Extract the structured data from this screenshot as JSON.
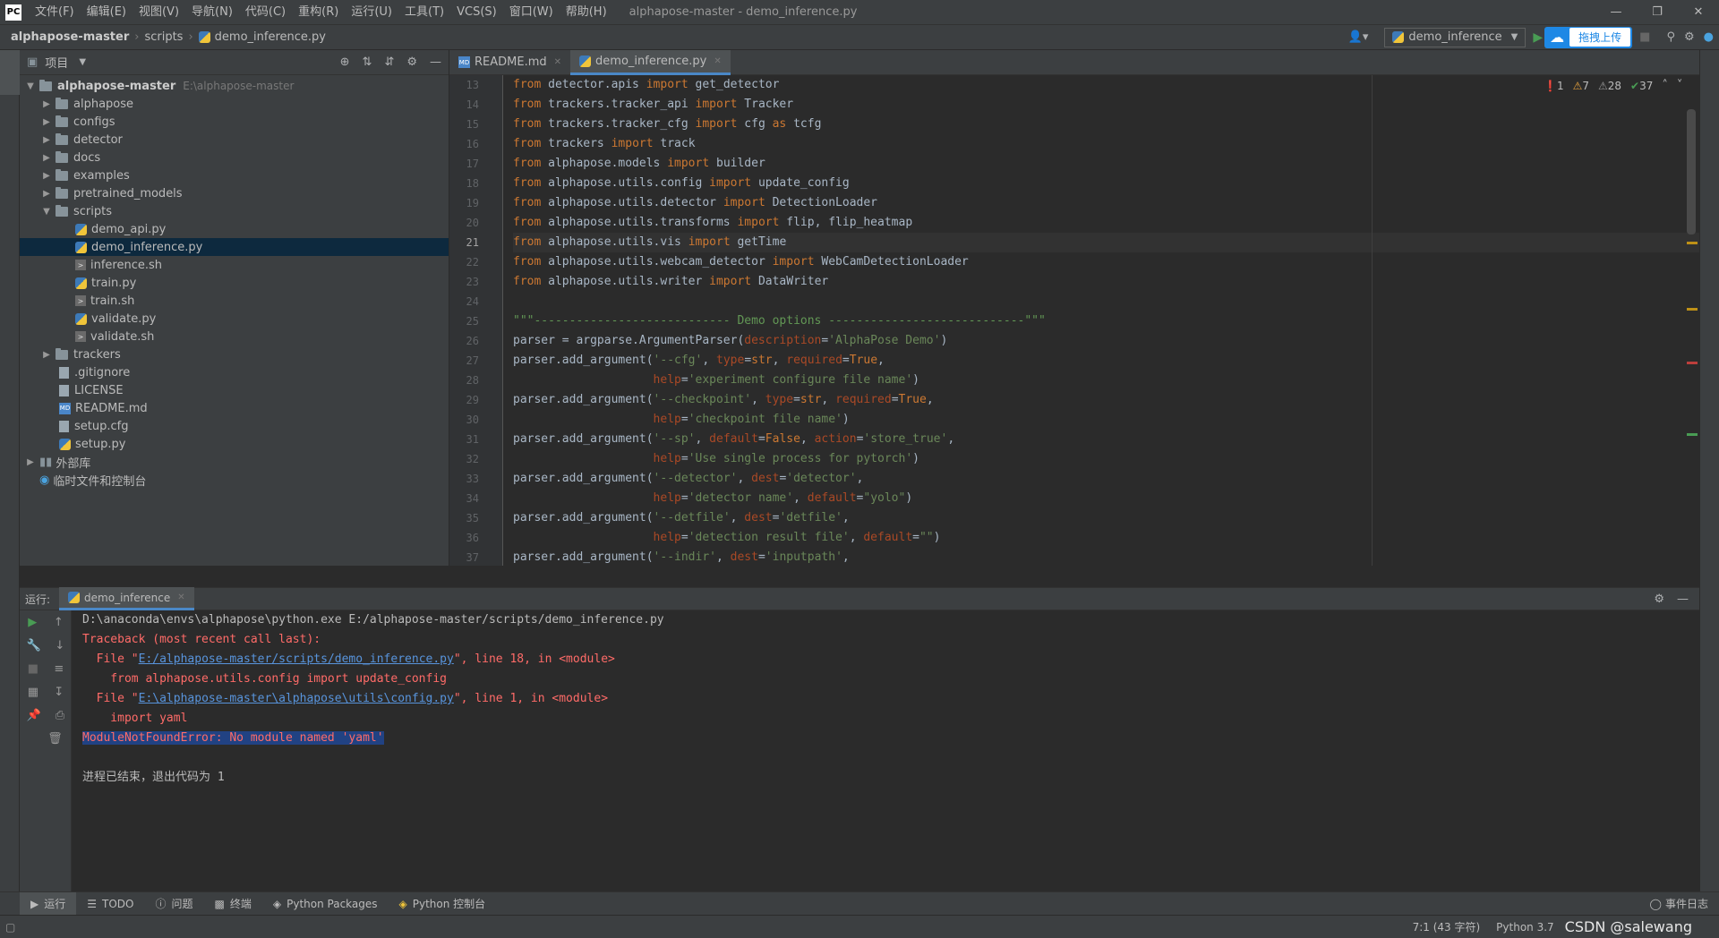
{
  "titlebar": {
    "logo": "PC",
    "menu": [
      "文件(F)",
      "编辑(E)",
      "视图(V)",
      "导航(N)",
      "代码(C)",
      "重构(R)",
      "运行(U)",
      "工具(T)",
      "VCS(S)",
      "窗口(W)",
      "帮助(H)"
    ],
    "title": "alphapose-master - demo_inference.py"
  },
  "navbar": {
    "breadcrumb": [
      "alphapose-master",
      "scripts",
      "demo_inference.py"
    ],
    "run_config": "demo_inference",
    "upload_label": "拖拽上传"
  },
  "project": {
    "title": "项目",
    "root": "alphapose-master",
    "root_path": "E:\\alphapose-master",
    "folders": [
      "alphapose",
      "configs",
      "detector",
      "docs",
      "examples",
      "pretrained_models"
    ],
    "scripts_folder": "scripts",
    "scripts": [
      "demo_api.py",
      "demo_inference.py",
      "inference.sh",
      "train.py",
      "train.sh",
      "validate.py",
      "validate.sh"
    ],
    "trackers": "trackers",
    "root_files": [
      ".gitignore",
      "LICENSE",
      "README.md",
      "setup.cfg",
      "setup.py"
    ],
    "external": "外部库",
    "scratches": "临时文件和控制台"
  },
  "tabs": [
    "README.md",
    "demo_inference.py"
  ],
  "inspections": {
    "errors": "1",
    "warnings": "7",
    "weak": "28",
    "ok": "37"
  },
  "editor": {
    "line_numbers": [
      "13",
      "14",
      "15",
      "16",
      "17",
      "18",
      "19",
      "20",
      "21",
      "22",
      "23",
      "24",
      "25",
      "26",
      "27",
      "28",
      "29",
      "30",
      "31",
      "32",
      "33",
      "34",
      "35",
      "36",
      "37"
    ]
  },
  "run": {
    "label": "运行:",
    "tab": "demo_inference",
    "lines": {
      "cmd": "D:\\anaconda\\envs\\alphapose\\python.exe E:/alphapose-master/scripts/demo_inference.py",
      "traceback": "Traceback (most recent call last):",
      "file1_pre": "  File \"",
      "file1_link": "E:/alphapose-master/scripts/demo_inference.py",
      "file1_post": "\", line 18, in <module>",
      "code1": "    from alphapose.utils.config import update_config",
      "file2_pre": "  File \"",
      "file2_link": "E:\\alphapose-master\\alphapose\\utils\\config.py",
      "file2_post": "\", line 1, in <module>",
      "code2": "    import yaml",
      "error": "ModuleNotFoundError: No module named 'yaml'",
      "exit": "进程已结束，退出代码为 1"
    }
  },
  "bottom_tabs": [
    "运行",
    "TODO",
    "问题",
    "终端",
    "Python Packages",
    "Python 控制台"
  ],
  "event_log": "事件日志",
  "status": {
    "position": "7:1 (43 字符)",
    "interpreter": "Python 3.7",
    "watermark": "CSDN @salewang"
  },
  "colors": {
    "accent": "#4a88c7",
    "error": "#ff6b68",
    "link": "#5894dc",
    "selection": "#214283"
  }
}
